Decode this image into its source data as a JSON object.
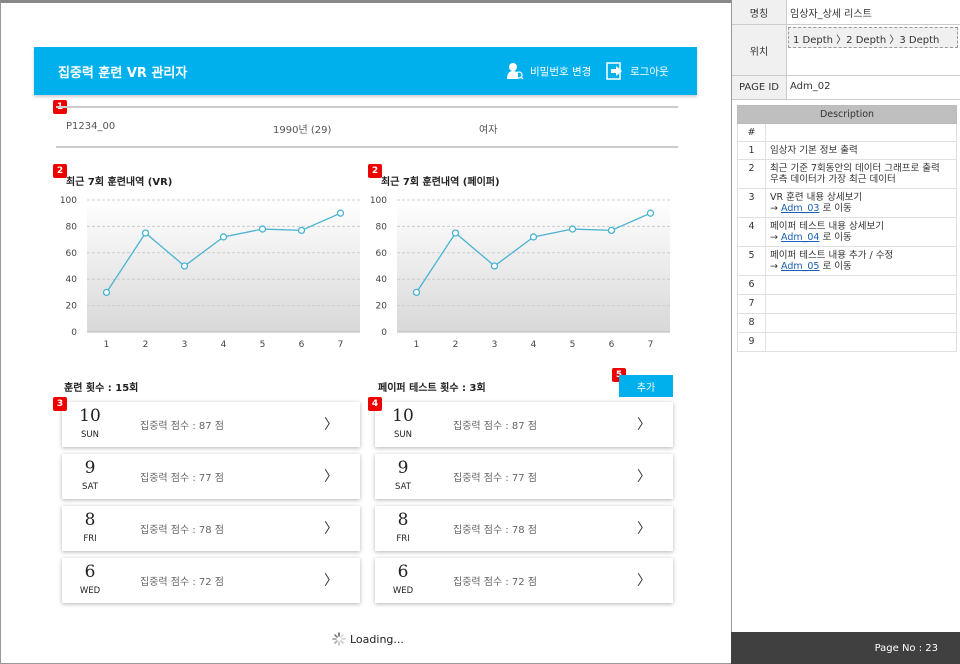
{
  "header": {
    "title": "집중력 훈련 VR 관리자",
    "change_password": "비밀번호 변경",
    "logout": "로그아웃",
    "accent": "#00b0ed"
  },
  "badges": [
    "1",
    "2",
    "2",
    "3",
    "4",
    "5"
  ],
  "patient": {
    "id": "P1234_00",
    "birth": "1990년 (29)",
    "gender": "여자"
  },
  "chart_data": [
    {
      "type": "line",
      "title": "최근 7회 훈련내역 (VR)",
      "categories": [
        "1",
        "2",
        "3",
        "4",
        "5",
        "6",
        "7"
      ],
      "values": [
        30,
        75,
        50,
        72,
        78,
        77,
        90
      ],
      "ylim": [
        0,
        100
      ],
      "yticks": [
        "0",
        "20",
        "40",
        "60",
        "80",
        "100"
      ],
      "grid": true,
      "color": "#4ab3d3"
    },
    {
      "type": "line",
      "title": "최근 7회 훈련내역 (페이퍼)",
      "categories": [
        "1",
        "2",
        "3",
        "4",
        "5",
        "6",
        "7"
      ],
      "values": [
        30,
        75,
        50,
        72,
        78,
        77,
        90
      ],
      "ylim": [
        0,
        100
      ],
      "yticks": [
        "0",
        "20",
        "40",
        "60",
        "80",
        "100"
      ],
      "grid": true,
      "color": "#4ab3d3"
    }
  ],
  "vr": {
    "title": "훈련 횟수 : 15회",
    "items": [
      {
        "day": "10",
        "dow": "SUN",
        "score": "집중력 점수 : 87 점"
      },
      {
        "day": "9",
        "dow": "SAT",
        "score": "집중력 점수 : 77 점"
      },
      {
        "day": "8",
        "dow": "FRI",
        "score": "집중력 점수 : 78 점"
      },
      {
        "day": "6",
        "dow": "WED",
        "score": "집중력 점수 : 72 점"
      }
    ]
  },
  "paper": {
    "title": "페이퍼 테스트 횟수 : 3회",
    "add": "추가",
    "items": [
      {
        "day": "10",
        "dow": "SUN",
        "score": "집중력 점수 : 87 점"
      },
      {
        "day": "9",
        "dow": "SAT",
        "score": "집중력 점수 : 77 점"
      },
      {
        "day": "8",
        "dow": "FRI",
        "score": "집중력 점수 : 78 점"
      },
      {
        "day": "6",
        "dow": "WED",
        "score": "집중력 점수 : 72 점"
      }
    ]
  },
  "chevron": "〉",
  "loading": "Loading...",
  "side": {
    "name_label": "명칭",
    "name": "임상자_상세 리스트",
    "loc_label": "위치",
    "loc": "1 Depth 〉2 Depth 〉3 Depth",
    "pid_label": "PAGE ID",
    "pid": "Adm_02",
    "desc_header": "Description",
    "hash": "#",
    "rows": [
      {
        "n": "1",
        "l1": "임상자 기본 정보 출력"
      },
      {
        "n": "2",
        "l1": "최근 기준 7회동안의 데이터 그래프로 출력",
        "l2": "우측 데이터가 가장 최근 데이터"
      },
      {
        "n": "3",
        "l1": "VR 훈련 내용 상세보기",
        "arrow": "→ ",
        "link": "Adm_03",
        "suffix": " 로 이동"
      },
      {
        "n": "4",
        "l1": "페이퍼 테스트 내용 상세보기",
        "arrow": "→ ",
        "link": "Adm_04",
        "suffix": " 로 이동"
      },
      {
        "n": "5",
        "l1": "페이퍼 테스트 내용 추가 / 수정",
        "arrow": "→ ",
        "link": "Adm_05",
        "suffix": " 로 이동"
      },
      {
        "n": "6"
      },
      {
        "n": "7"
      },
      {
        "n": "8"
      },
      {
        "n": "9"
      }
    ]
  },
  "footer": "Page No : 23"
}
